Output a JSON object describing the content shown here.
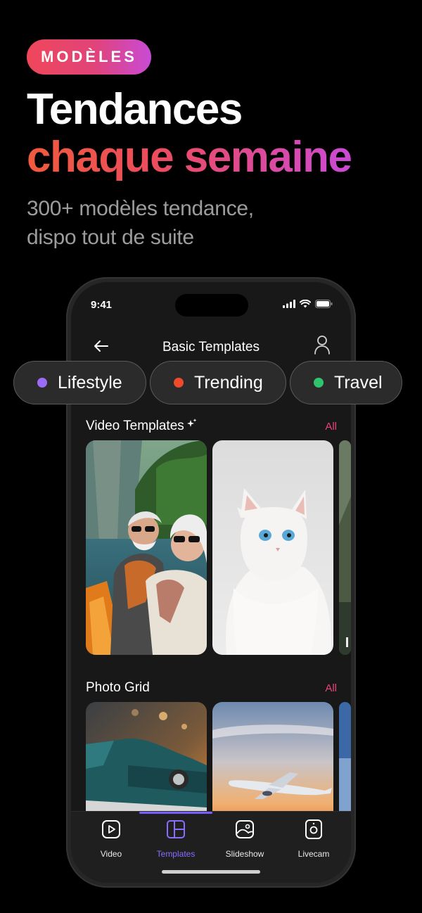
{
  "badge": "MODÈLES",
  "headline": {
    "line1": "Tendances",
    "line2": "chaque semaine"
  },
  "subtitle": {
    "line1": "300+ modèles tendance,",
    "line2": "dispo tout de suite"
  },
  "phone": {
    "status_time": "9:41",
    "nav_title": "Basic Templates",
    "sections": [
      {
        "title": "Video Templates",
        "all_label": "All"
      },
      {
        "title": "Photo Grid",
        "all_label": "All"
      }
    ],
    "tabs": [
      {
        "label": "Video",
        "icon": "play-icon"
      },
      {
        "label": "Templates",
        "icon": "templates-grid-icon",
        "active": true
      },
      {
        "label": "Slideshow",
        "icon": "slideshow-icon"
      },
      {
        "label": "Livecam",
        "icon": "camera-icon"
      }
    ]
  },
  "chips": [
    {
      "label": "Lifestyle",
      "color": "#9b6cf5"
    },
    {
      "label": "Trending",
      "color": "#ef4a2e"
    },
    {
      "label": "Travel",
      "color": "#2fc46e"
    }
  ],
  "colors": {
    "accent": "#e8437e",
    "active_tab": "#8a6cff"
  }
}
